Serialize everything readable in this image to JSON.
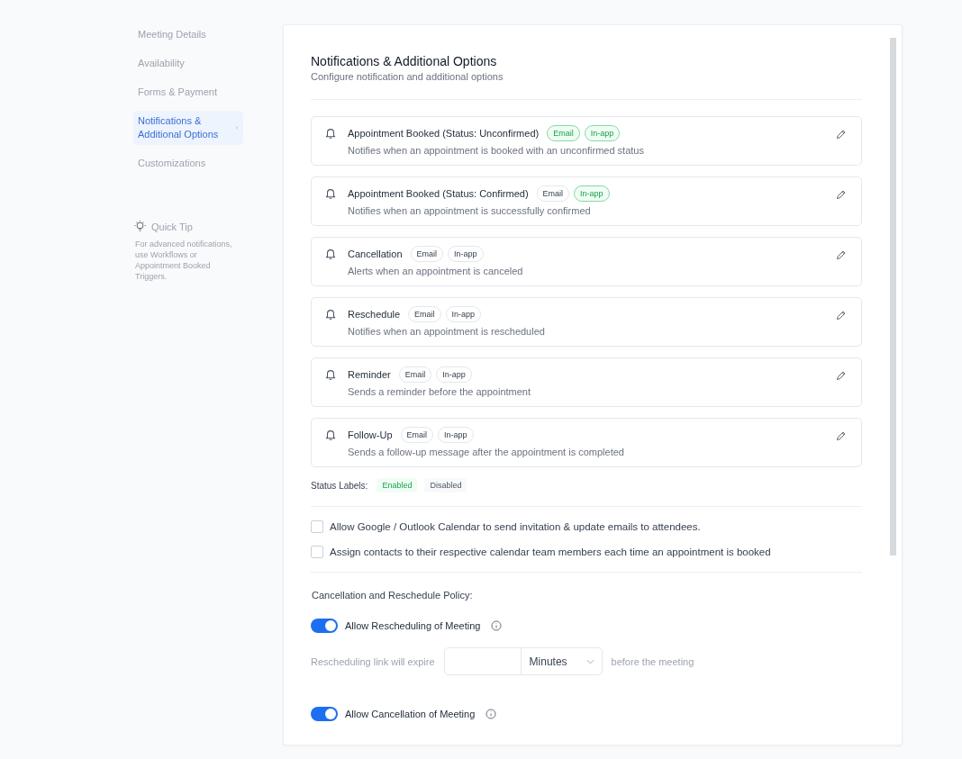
{
  "sidebar": {
    "items": [
      {
        "label": "Meeting Details",
        "selected": false
      },
      {
        "label": "Availability",
        "selected": false
      },
      {
        "label": "Forms & Payment",
        "selected": false
      },
      {
        "label": "Notifications & Additional Options",
        "selected": true
      },
      {
        "label": "Customizations",
        "selected": false
      }
    ],
    "tip": {
      "title": "Quick Tip",
      "text": "For advanced notifications, use Workflows or Appointment Booked Triggers."
    }
  },
  "panel": {
    "title": "Notifications & Additional Options",
    "subtitle": "Configure notification and additional options",
    "notifications": [
      {
        "title": "Appointment Booked (Status: Unconfirmed)",
        "description": "Notifies when an appointment is booked with an unconfirmed status",
        "channels": [
          {
            "label": "Email",
            "enabled": true
          },
          {
            "label": "In-app",
            "enabled": true
          }
        ]
      },
      {
        "title": "Appointment Booked (Status: Confirmed)",
        "description": "Notifies when an appointment is successfully confirmed",
        "channels": [
          {
            "label": "Email",
            "enabled": false
          },
          {
            "label": "In-app",
            "enabled": true
          }
        ]
      },
      {
        "title": "Cancellation",
        "description": "Alerts when an appointment is canceled",
        "channels": [
          {
            "label": "Email",
            "enabled": false
          },
          {
            "label": "In-app",
            "enabled": false
          }
        ]
      },
      {
        "title": "Reschedule",
        "description": "Notifies when an appointment is rescheduled",
        "channels": [
          {
            "label": "Email",
            "enabled": false
          },
          {
            "label": "In-app",
            "enabled": false
          }
        ]
      },
      {
        "title": "Reminder",
        "description": "Sends a reminder before the appointment",
        "channels": [
          {
            "label": "Email",
            "enabled": false
          },
          {
            "label": "In-app",
            "enabled": false
          }
        ]
      },
      {
        "title": "Follow-Up",
        "description": "Sends a follow-up message after the appointment is completed",
        "channels": [
          {
            "label": "Email",
            "enabled": false
          },
          {
            "label": "In-app",
            "enabled": false
          }
        ]
      }
    ],
    "status_labels": {
      "label": "Status Labels:",
      "items": [
        {
          "label": "Enabled",
          "enabled": true
        },
        {
          "label": "Disabled",
          "enabled": false
        }
      ]
    },
    "options": [
      {
        "label": "Allow Google / Outlook Calendar to send invitation & update emails to attendees.",
        "checked": false
      },
      {
        "label": "Assign contacts to their respective calendar team members each time an appointment is booked",
        "checked": false
      }
    ],
    "policy": {
      "title": "Cancellation and Reschedule Policy:",
      "reschedule": {
        "label": "Allow Rescheduling of Meeting",
        "on": true
      },
      "expiry": {
        "prefix": "Rescheduling link will expire",
        "unit": "Minutes",
        "suffix": "before the meeting"
      },
      "cancellation": {
        "label": "Allow Cancellation of Meeting",
        "on": true
      }
    }
  }
}
